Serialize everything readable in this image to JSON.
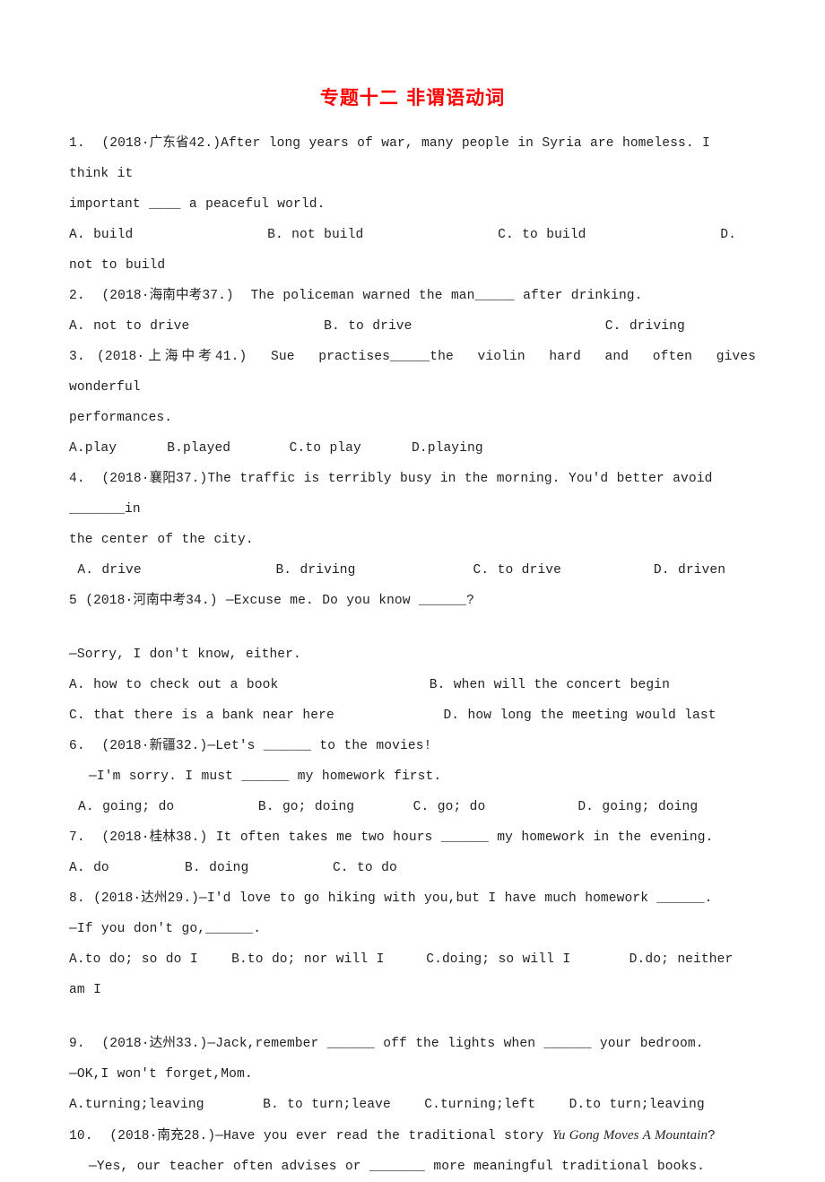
{
  "document": {
    "title": "专题十二 非谓语动词",
    "title_color": "#ff0000",
    "text_color": "#231f20"
  },
  "questions": [
    {
      "id": "q1",
      "stem_line1": "1.  (2018·广东省42.)After long years of war, many people in Syria are homeless. I think it",
      "stem_line2": "important ____ a peaceful world.",
      "options_line1": "A. build                B. not build                C. to build                D. not to build"
    },
    {
      "id": "q2",
      "stem_line1": "2.  (2018·海南中考37.)  The policeman warned the man_____ after drinking.",
      "options_line1": "A. not to drive                B. to drive                       C. driving"
    },
    {
      "id": "q3",
      "stem_line1": "3. (2018·上海中考41.)  Sue  practises_____the  violin  hard  and  often  gives  wonderful",
      "stem_line2": "performances.",
      "options_line1": "A.play      B.played       C.to play      D.playing"
    },
    {
      "id": "q4",
      "stem_line1": "4.  (2018·襄阳37.)The traffic is terribly busy in the morning. You'd better avoid _______in",
      "stem_line2": "the center of the city.",
      "options_line1": " A. drive                B. driving              C. to drive           D. driven"
    },
    {
      "id": "q5",
      "stem_line1": "5 (2018·河南中考34.) —Excuse me. Do you know ______?",
      "stem_line2": "—Sorry, I don't know, either.",
      "options_line1": "A. how to check out a book                  B. when will the concert begin",
      "options_line2": "C. that there is a bank near here             D. how long the meeting would last"
    },
    {
      "id": "q6",
      "stem_line1": "6.  (2018·新疆32.)—Let's ______ to the movies!",
      "stem_line2": "—I'm sorry. I must ______ my homework first.",
      "options_line1": "A. going; do          B. go; doing       C. go; do           D. going; doing"
    },
    {
      "id": "q7",
      "stem_line1": "7.  (2018·桂林38.) It often takes me two hours ______ my homework in the evening.",
      "options_line1": "A. do         B. doing          C. to do"
    },
    {
      "id": "q8",
      "stem_line1": "8. (2018·达州29.)—I'd love to go hiking with you,but I have much homework ______.",
      "stem_line2": "—If you don't go,______.",
      "options_line1": "A.to do; so do I    B.to do; nor will I     C.doing; so will I       D.do; neither am I"
    },
    {
      "id": "q9",
      "stem_line1": "9.  (2018·达州33.)—Jack,remember ______ off the lights when ______ your bedroom.",
      "stem_line2": "—OK,I won't forget,Mom.",
      "options_line1": "A.turning;leaving       B. to turn;leave    C.turning;left    D.to turn;leaving"
    },
    {
      "id": "q10",
      "stem_prefix": "10.  (2018·南充28.)—Have you ever read the traditional story ",
      "stem_italic": "Yu Gong Moves A Mountain",
      "stem_suffix": "?",
      "stem_line2": "—Yes, our teacher often advises or _______ more meaningful traditional books."
    }
  ]
}
